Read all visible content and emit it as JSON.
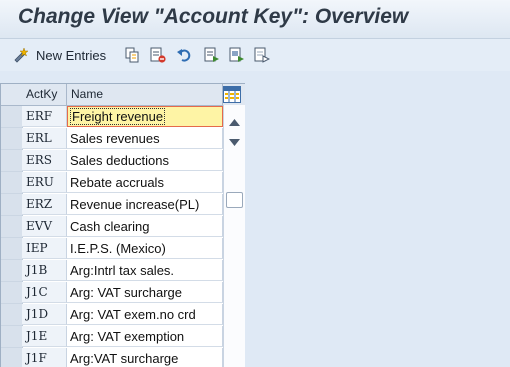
{
  "title": "Change View \"Account Key\": Overview",
  "toolbar": {
    "new_entries_label": "New Entries",
    "icons": [
      "new-entries-icon",
      "copy-icon",
      "delete-icon",
      "undo-icon",
      "select-all-icon",
      "select-block-icon",
      "deselect-all-icon"
    ]
  },
  "table": {
    "headers": {
      "key": "ActKy",
      "name": "Name"
    },
    "rows": [
      {
        "key": "ERF",
        "name": "Freight revenue"
      },
      {
        "key": "ERL",
        "name": "Sales revenues"
      },
      {
        "key": "ERS",
        "name": "Sales deductions"
      },
      {
        "key": "ERU",
        "name": "Rebate accruals"
      },
      {
        "key": "ERZ",
        "name": "Revenue increase(PL)"
      },
      {
        "key": "EVV",
        "name": "Cash clearing"
      },
      {
        "key": "IEP",
        "name": "I.E.P.S. (Mexico)"
      },
      {
        "key": "J1B",
        "name": "Arg:Intrl tax sales."
      },
      {
        "key": "J1C",
        "name": "Arg: VAT surcharge"
      },
      {
        "key": "J1D",
        "name": "Arg: VAT exem.no crd"
      },
      {
        "key": "J1E",
        "name": "Arg: VAT exemption"
      },
      {
        "key": "J1F",
        "name": "Arg:VAT surcharge"
      }
    ],
    "active_row": 0
  },
  "colors": {
    "accent": "#fef4a5",
    "focus_border": "#e56a4b",
    "background": "#dfe9f5"
  }
}
